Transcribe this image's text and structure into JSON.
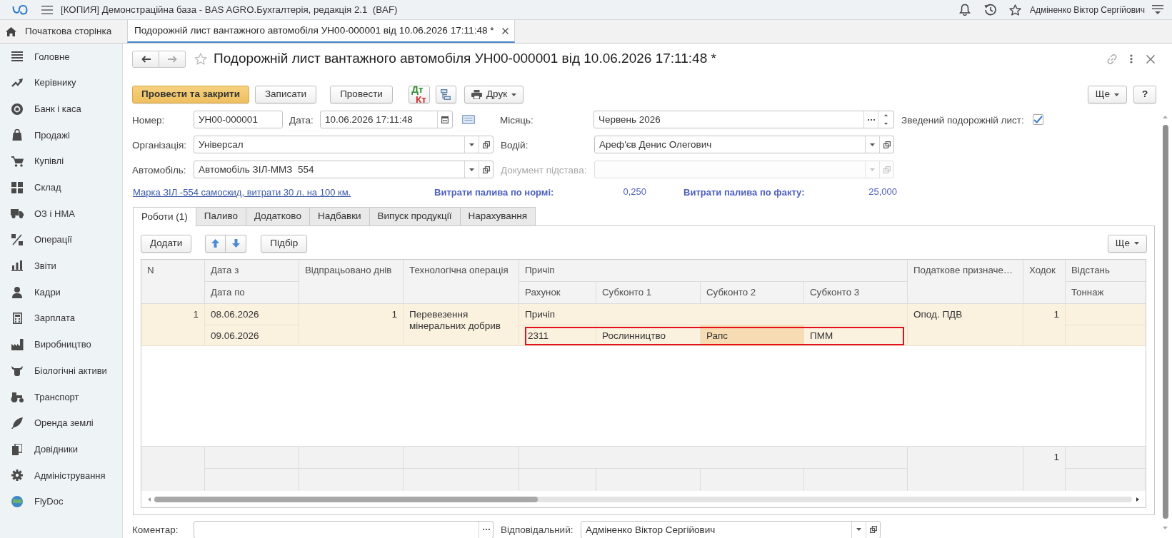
{
  "app_header": {
    "title": "[КОПИЯ] Демонстраційна база - BAS AGRO.Бухгалтерія, редакція 2.1  (BAF)",
    "user": "Адміненко Віктор Сергійович"
  },
  "open_tabs": [
    {
      "kind": "home",
      "label": "Початкова сторінка",
      "selected": false
    },
    {
      "kind": "document",
      "label": "Подорожній лист вантажного автомобіля УН00-000001 від 10.06.2026 17:11:48 *",
      "selected": true
    }
  ],
  "sidebar": {
    "items": [
      {
        "label": "Головне"
      },
      {
        "label": "Керівнику"
      },
      {
        "label": "Банк і каса"
      },
      {
        "label": "Продажі"
      },
      {
        "label": "Купівлі"
      },
      {
        "label": "Склад"
      },
      {
        "label": "ОЗ і НМА"
      },
      {
        "label": "Операції"
      },
      {
        "label": "Звіти"
      },
      {
        "label": "Кадри"
      },
      {
        "label": "Зарплата"
      },
      {
        "label": "Виробництво"
      },
      {
        "label": "Біологічні активи"
      },
      {
        "label": "Транспорт"
      },
      {
        "label": "Оренда землі"
      },
      {
        "label": "Довідники"
      },
      {
        "label": "Адміністрування"
      },
      {
        "label": "FlyDoc"
      }
    ]
  },
  "document": {
    "title": "Подорожній лист вантажного автомобіля УН00-000001 від 10.06.2026 17:11:48 *"
  },
  "toolbar": {
    "buttons": [
      {
        "kind": "primary",
        "label": "Провести та закрити"
      },
      {
        "kind": "plain",
        "label": "Записати"
      },
      {
        "kind": "plain",
        "label": "Провести"
      },
      {
        "kind": "postings",
        "debit": "Дт",
        "credit": "Кт"
      },
      {
        "kind": "structure"
      },
      {
        "kind": "print",
        "label": "Друк"
      },
      {
        "kind": "menu",
        "label": "Ще"
      },
      {
        "kind": "help",
        "label": "?"
      }
    ]
  },
  "form": {
    "number": {
      "label": "Номер:",
      "value": "УН00-000001"
    },
    "date": {
      "label": "Дата:",
      "value": "10.06.2026 17:11:48"
    },
    "month": {
      "label": "Місяць:",
      "value": "Червень 2026"
    },
    "consolidated": {
      "label": "Зведений подорожній лист:",
      "checked": true
    },
    "organization": {
      "label": "Організація:",
      "value": "Універсал"
    },
    "driver": {
      "label": "Водій:",
      "value": "Ареф'єв Денис Олегович"
    },
    "vehicle": {
      "label": "Автомобіль:",
      "value": "Автомобіль ЗІЛ-ММЗ  554"
    },
    "base_document": {
      "label": "Документ підстава:",
      "disabled": true
    },
    "vehicle_info_link": "Марка ЗІЛ -554 самоскид, витрати 30 л. на 100 км.",
    "fuel_norm": {
      "label": "Витрати палива по нормі:",
      "value": "0,250"
    },
    "fuel_actual": {
      "label": "Витрати палива по факту:",
      "value": "25,000"
    }
  },
  "tabs": [
    {
      "label": "Роботи (1)",
      "selected": true
    },
    {
      "label": "Паливо",
      "selected": false
    },
    {
      "label": "Додатково",
      "selected": false
    },
    {
      "label": "Надбавки",
      "selected": false
    },
    {
      "label": "Випуск продукції",
      "selected": false
    },
    {
      "label": "Нарахування",
      "selected": false
    }
  ],
  "table_toolbar": {
    "buttons": [
      {
        "kind": "plain",
        "label": "Додати"
      },
      {
        "kind": "move_arrows"
      },
      {
        "kind": "plain",
        "label": "Підбір"
      },
      {
        "kind": "menu",
        "label": "Ще"
      }
    ]
  },
  "table": {
    "header": {
      "n": "N",
      "date_from": "Дата з",
      "date_to": "Дата по",
      "days": "Відпрацьовано днів",
      "operation": "Технологічна операція",
      "trailer": "Причіп",
      "account": "Рахунок",
      "subconto_1": "Субконто 1",
      "subconto_2": "Субконто 2",
      "subconto_3": "Субконто 3",
      "tax": "Податкове призначе…",
      "trips": "Ходок",
      "distance": "Відстань",
      "tonnage": "Тоннаж"
    },
    "rows": [
      {
        "selected": true,
        "n": "1",
        "date_from": "08.06.2026",
        "date_to": "09.06.2026",
        "days": "1",
        "operation": "Перевезення мінеральних добрив",
        "trailer": "Причіп",
        "analytics": {
          "highlighted": true,
          "cells": [
            {
              "text": "2311",
              "selected": false
            },
            {
              "text": "Рослинництво",
              "selected": false
            },
            {
              "text": "Рапс",
              "selected": true
            },
            {
              "text": "ПММ",
              "selected": false
            }
          ]
        },
        "tax": "Опод. ПДВ",
        "trips": "1"
      }
    ],
    "totals": {
      "trips": "1"
    }
  },
  "comment": {
    "label": "Коментар:"
  },
  "responsible": {
    "label": "Відповідальний:",
    "value": "Адміненко Віктор Сергійович"
  }
}
